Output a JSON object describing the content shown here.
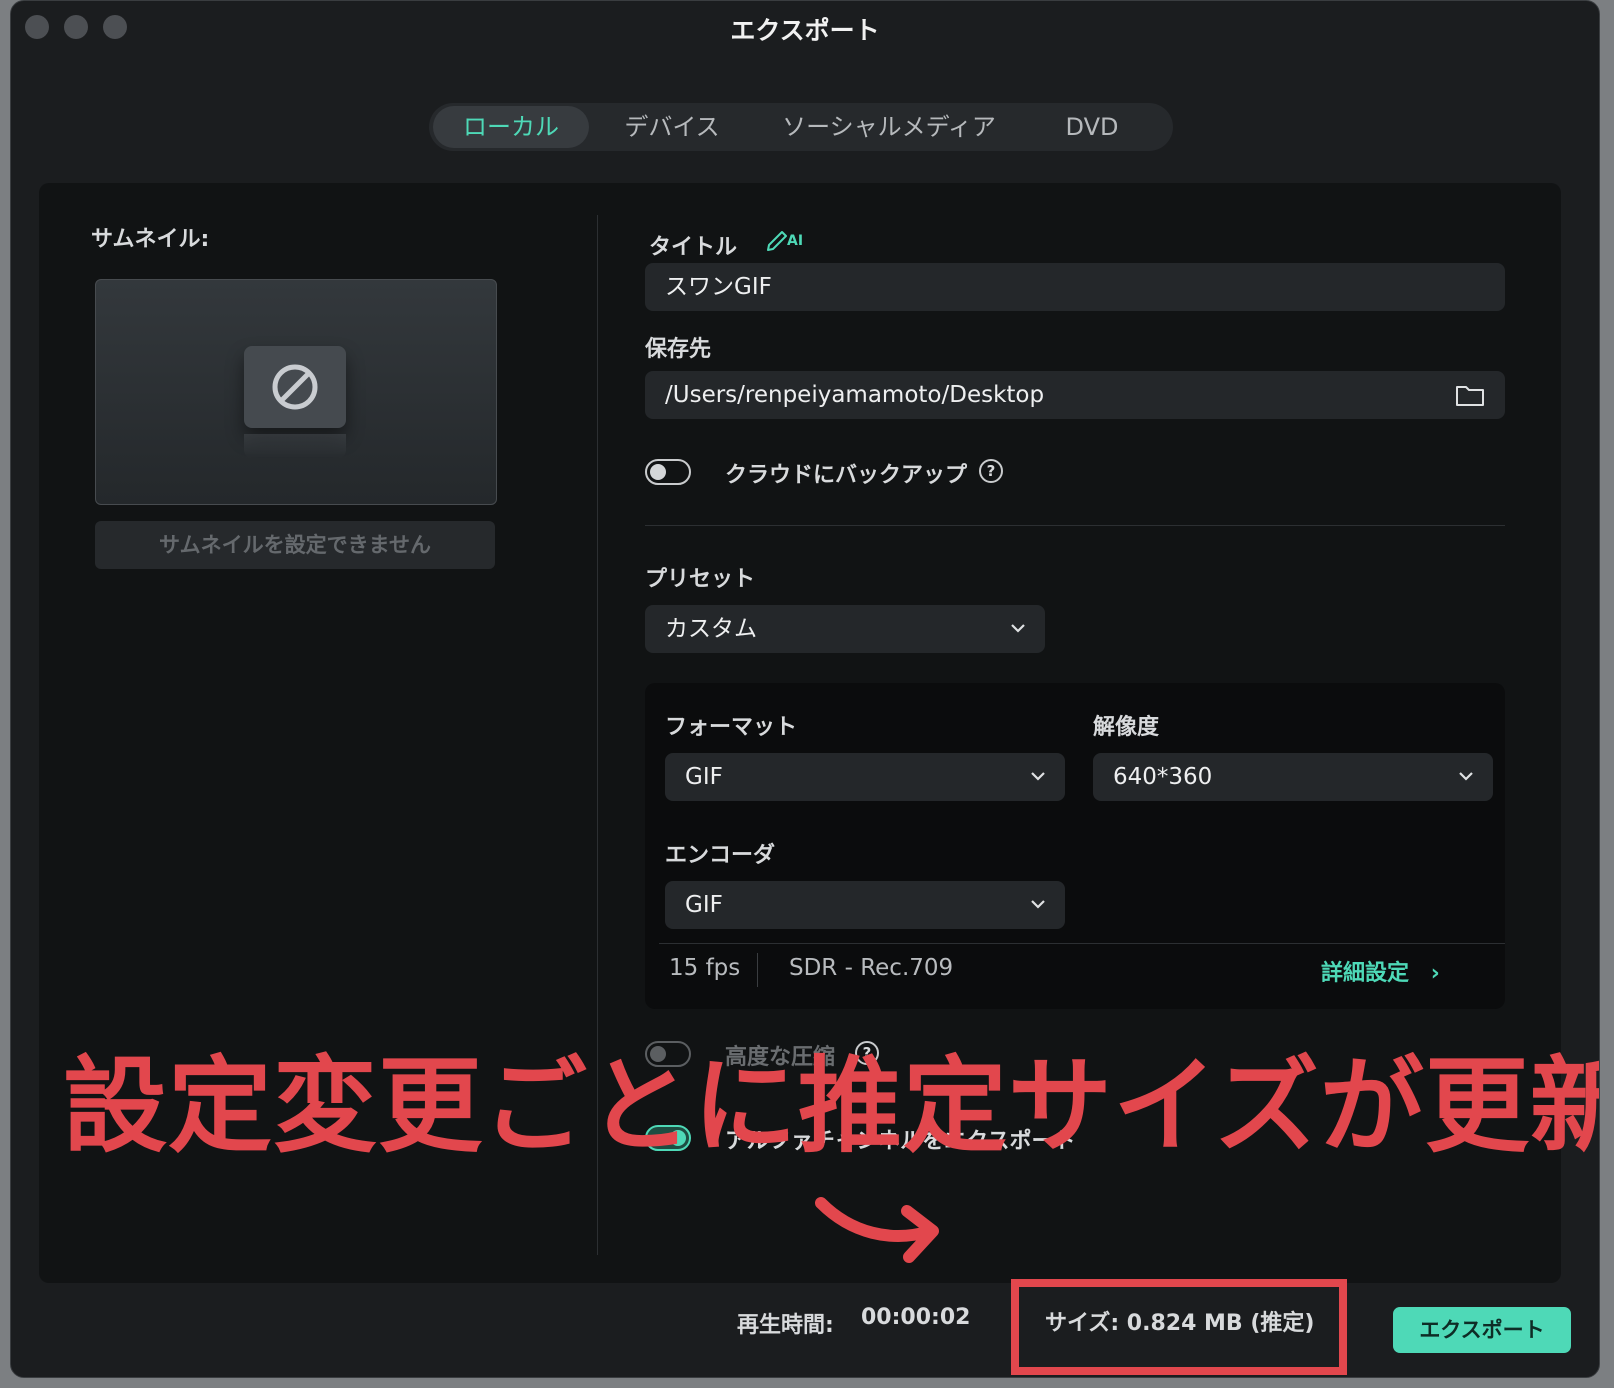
{
  "window": {
    "title": "エクスポート"
  },
  "tabs": [
    {
      "label": "ローカル",
      "active": true
    },
    {
      "label": "デバイス",
      "active": false
    },
    {
      "label": "ソーシャルメディア",
      "active": false
    },
    {
      "label": "DVD",
      "active": false
    }
  ],
  "thumbnail": {
    "label": "サムネイル:",
    "button_label": "サムネイルを設定できません",
    "icon": "no-entry-icon"
  },
  "form": {
    "title_label": "タイトル",
    "ai_badge": "AI",
    "title_value": "スワンGIF",
    "save_label": "保存先",
    "save_path": "/Users/renpeiyamamoto/Desktop",
    "cloud_backup_label": "クラウドにバックアップ",
    "cloud_backup_on": false,
    "preset_label": "プリセット",
    "preset_value": "カスタム",
    "format_label": "フォーマット",
    "format_value": "GIF",
    "resolution_label": "解像度",
    "resolution_value": "640*360",
    "encoder_label": "エンコーダ",
    "encoder_value": "GIF",
    "fps": "15 fps",
    "color_space": "SDR - Rec.709",
    "advanced_label": "詳細設定",
    "compression_label": "高度な圧縮",
    "compression_on": false,
    "alpha_label": "アルファチャンネルをエクスポート",
    "alpha_on": true
  },
  "annotation": {
    "text": "設定変更ごとに推定サイズが更新",
    "color": "#e2474d"
  },
  "footer": {
    "duration_label": "再生時間:",
    "duration_value": "00:00:02",
    "size_text": "サイズ:  0.824 MB (推定)",
    "export_label": "エクスポート"
  },
  "colors": {
    "accent": "#4ed9b7",
    "annotation": "#e2474d",
    "background": "#1b1d1f"
  }
}
